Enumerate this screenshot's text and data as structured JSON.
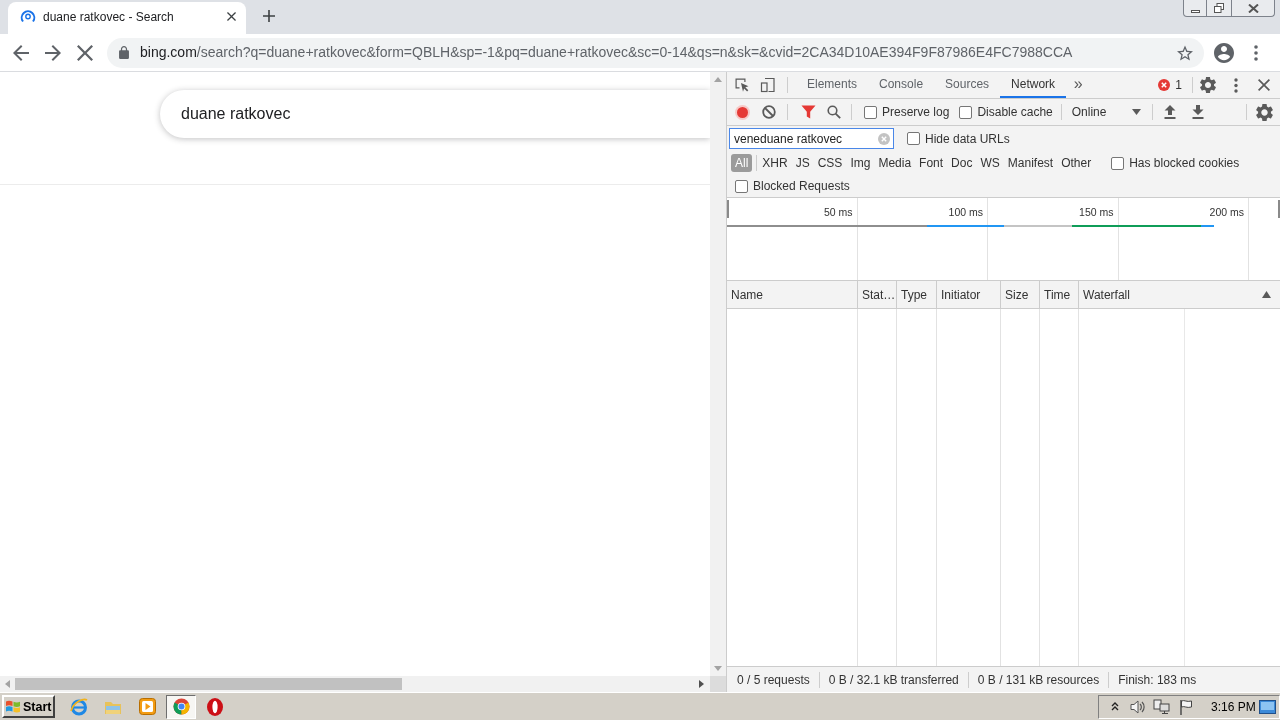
{
  "browser": {
    "tabs": [
      {
        "title": "duane ratkovec - Search",
        "selected": true
      }
    ],
    "loading": true,
    "address": {
      "host": "bing.com",
      "path": "/search?q=duane+ratkovec&form=QBLH&sp=-1&pq=duane+ratkovec&sc=0-14&qs=n&sk=&cvid=2CA34D10AE394F9F87986E4FC7988CCA"
    }
  },
  "page": {
    "search_box": {
      "value": "duane ratkovec"
    }
  },
  "devtools": {
    "tabs": [
      {
        "label": "Elements",
        "selected": false
      },
      {
        "label": "Console",
        "selected": false
      },
      {
        "label": "Sources",
        "selected": false
      },
      {
        "label": "Network",
        "selected": true
      }
    ],
    "more_tabs": "»",
    "error_count": "1",
    "toolbar": {
      "recording": true,
      "filter_shown": true,
      "options": [
        {
          "label": "Preserve log",
          "checked": false
        },
        {
          "label": "Disable cache",
          "checked": false
        }
      ],
      "throttling": "Online"
    },
    "filter": {
      "value": "veneduane ratkovec",
      "hide_data_urls": {
        "label": "Hide data URLs",
        "checked": false
      }
    },
    "type_filters": [
      {
        "label": "All",
        "selected": true
      },
      {
        "label": "XHR",
        "selected": false
      },
      {
        "label": "JS",
        "selected": false
      },
      {
        "label": "CSS",
        "selected": false
      },
      {
        "label": "Img",
        "selected": false
      },
      {
        "label": "Media",
        "selected": false
      },
      {
        "label": "Font",
        "selected": false
      },
      {
        "label": "Doc",
        "selected": false
      },
      {
        "label": "WS",
        "selected": false
      },
      {
        "label": "Manifest",
        "selected": false
      },
      {
        "label": "Other",
        "selected": false
      }
    ],
    "blocked_cookies": {
      "label": "Has blocked cookies",
      "checked": false
    },
    "blocked_requests": {
      "label": "Blocked Requests",
      "checked": false
    },
    "overview": {
      "ticks": [
        "50 ms",
        "100 ms",
        "150 ms",
        "200 ms"
      ]
    },
    "table": {
      "columns": [
        "Name",
        "Stat…",
        "Type",
        "Initiator",
        "Size",
        "Time",
        "Waterfall"
      ]
    },
    "status_bar": [
      "0 / 5 requests",
      "0 B / 32.1 kB transferred",
      "0 B / 131 kB resources",
      "Finish: 183 ms"
    ]
  },
  "taskbar": {
    "start": "Start",
    "apps": [
      {
        "kind": "ie",
        "selected": false
      },
      {
        "kind": "folder",
        "selected": false
      },
      {
        "kind": "player",
        "selected": false
      },
      {
        "kind": "chrome",
        "selected": true
      },
      {
        "kind": "ring",
        "selected": false
      }
    ],
    "clock": "3:16 PM"
  }
}
